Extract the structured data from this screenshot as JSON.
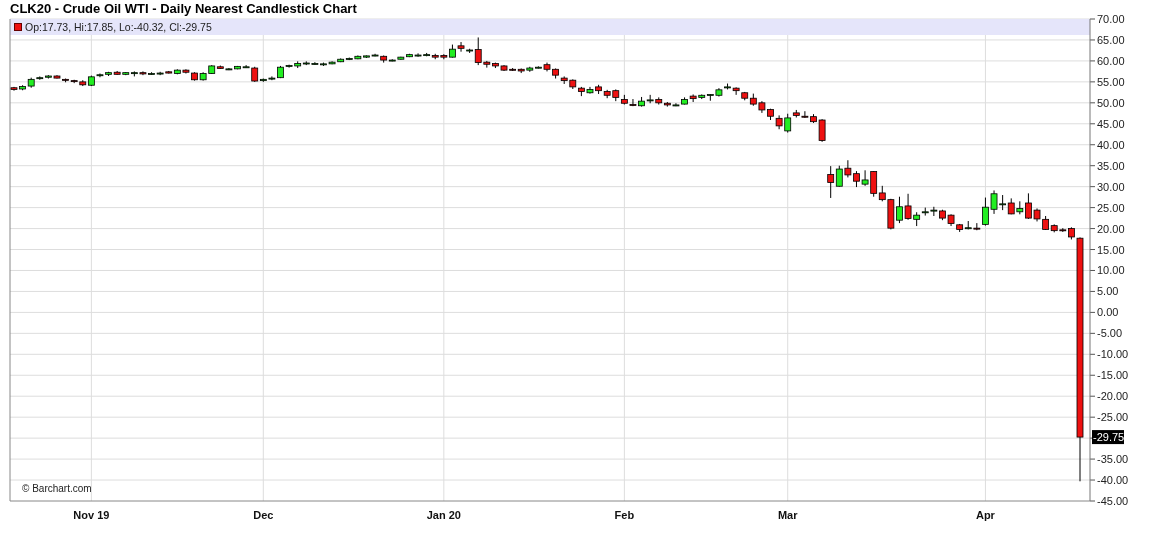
{
  "title": "CLK20 - Crude Oil WTI - Daily Nearest Candlestick Chart",
  "legend": {
    "text": "Op:17.73, Hi:17.85, Lo:-40.32, Cl:-29.75"
  },
  "copyright": "© Barchart.com",
  "chart": {
    "last_price_label": "-29.75",
    "chart_data": {
      "type": "candlestick",
      "grid": true,
      "ylim": [
        -45,
        70
      ],
      "yticks": [
        {
          "value": 70,
          "label": "70.00"
        },
        {
          "value": 65,
          "label": "65.00"
        },
        {
          "value": 60,
          "label": "60.00"
        },
        {
          "value": 55,
          "label": "55.00"
        },
        {
          "value": 50,
          "label": "50.00"
        },
        {
          "value": 45,
          "label": "45.00"
        },
        {
          "value": 40,
          "label": "40.00"
        },
        {
          "value": 35,
          "label": "35.00"
        },
        {
          "value": 30,
          "label": "30.00"
        },
        {
          "value": 25,
          "label": "25.00"
        },
        {
          "value": 20,
          "label": "20.00"
        },
        {
          "value": 15,
          "label": "15.00"
        },
        {
          "value": 10,
          "label": "10.00"
        },
        {
          "value": 5,
          "label": "5.00"
        },
        {
          "value": 0,
          "label": "0.00"
        },
        {
          "value": -5,
          "label": "-5.00"
        },
        {
          "value": -10,
          "label": "-10.00"
        },
        {
          "value": -15,
          "label": "-15.00"
        },
        {
          "value": -20,
          "label": "-20.00"
        },
        {
          "value": -25,
          "label": "-25.00"
        },
        {
          "value": -35,
          "label": "-35.00"
        },
        {
          "value": -40,
          "label": "-40.00"
        },
        {
          "value": -45,
          "label": "-45.00"
        }
      ],
      "categories": [
        null,
        null,
        null,
        null,
        null,
        null,
        null,
        null,
        null,
        "Nov 19",
        null,
        null,
        null,
        null,
        null,
        null,
        null,
        null,
        null,
        null,
        null,
        null,
        null,
        null,
        null,
        null,
        null,
        null,
        null,
        "Dec",
        null,
        null,
        null,
        null,
        null,
        null,
        null,
        null,
        null,
        null,
        null,
        null,
        null,
        null,
        null,
        null,
        null,
        null,
        null,
        null,
        "Jan 20",
        null,
        null,
        null,
        null,
        null,
        null,
        null,
        null,
        null,
        null,
        null,
        null,
        null,
        null,
        null,
        null,
        null,
        null,
        null,
        null,
        "Feb",
        null,
        null,
        null,
        null,
        null,
        null,
        null,
        null,
        null,
        null,
        null,
        null,
        null,
        null,
        null,
        null,
        null,
        null,
        "Mar",
        null,
        null,
        null,
        null,
        null,
        null,
        null,
        null,
        null,
        null,
        null,
        null,
        null,
        null,
        null,
        null,
        null,
        null,
        null,
        null,
        null,
        null,
        "Apr",
        null,
        null,
        null,
        null,
        null,
        null,
        null,
        null,
        null,
        null,
        null
      ],
      "ohlc": [
        [
          53.6,
          53.8,
          52.9,
          53.2
        ],
        [
          53.3,
          54.2,
          53.0,
          53.9
        ],
        [
          54.0,
          56.0,
          53.6,
          55.6
        ],
        [
          55.9,
          56.3,
          55.5,
          56.0
        ],
        [
          56.1,
          56.6,
          55.8,
          56.4
        ],
        [
          56.4,
          56.6,
          55.8,
          55.9
        ],
        [
          55.6,
          55.8,
          54.9,
          55.5
        ],
        [
          55.3,
          55.5,
          54.7,
          55.2
        ],
        [
          55.0,
          55.4,
          54.0,
          54.3
        ],
        [
          54.2,
          56.5,
          54.0,
          56.2
        ],
        [
          56.6,
          57.0,
          56.1,
          56.7
        ],
        [
          56.8,
          57.4,
          56.4,
          57.2
        ],
        [
          57.3,
          57.6,
          56.7,
          56.8
        ],
        [
          56.8,
          57.3,
          56.6,
          57.2
        ],
        [
          57.2,
          57.5,
          56.3,
          57.2
        ],
        [
          57.2,
          57.5,
          56.6,
          56.9
        ],
        [
          57.0,
          57.3,
          56.7,
          57.0
        ],
        [
          57.0,
          57.4,
          56.6,
          57.1
        ],
        [
          57.4,
          57.6,
          57.0,
          57.1
        ],
        [
          57.0,
          58.0,
          56.8,
          57.8
        ],
        [
          57.8,
          58.0,
          57.0,
          57.3
        ],
        [
          57.1,
          57.3,
          55.3,
          55.5
        ],
        [
          55.5,
          57.3,
          55.3,
          57.0
        ],
        [
          57.0,
          59.0,
          56.9,
          58.8
        ],
        [
          58.6,
          58.9,
          58.1,
          58.2
        ],
        [
          58.1,
          58.3,
          57.8,
          58.1
        ],
        [
          58.1,
          58.8,
          58.0,
          58.7
        ],
        [
          58.6,
          59.0,
          58.3,
          58.6
        ],
        [
          58.3,
          58.6,
          55.0,
          55.2
        ],
        [
          55.3,
          55.8,
          55.0,
          55.6
        ],
        [
          55.9,
          56.3,
          55.4,
          55.9
        ],
        [
          56.0,
          58.8,
          55.9,
          58.5
        ],
        [
          58.8,
          59.1,
          58.4,
          58.9
        ],
        [
          58.8,
          59.9,
          58.3,
          59.4
        ],
        [
          59.5,
          59.9,
          59.0,
          59.5
        ],
        [
          59.4,
          59.7,
          59.1,
          59.4
        ],
        [
          59.3,
          59.6,
          58.8,
          59.3
        ],
        [
          59.3,
          59.9,
          59.2,
          59.7
        ],
        [
          59.8,
          60.6,
          59.7,
          60.4
        ],
        [
          60.5,
          60.8,
          60.2,
          60.6
        ],
        [
          60.5,
          61.3,
          60.4,
          61.1
        ],
        [
          60.9,
          61.3,
          60.7,
          61.2
        ],
        [
          61.4,
          61.7,
          61.1,
          61.4
        ],
        [
          61.1,
          61.3,
          59.6,
          60.2
        ],
        [
          60.2,
          60.4,
          59.9,
          60.2
        ],
        [
          60.4,
          61.0,
          60.3,
          60.9
        ],
        [
          61.0,
          61.7,
          60.9,
          61.5
        ],
        [
          61.4,
          61.8,
          61.0,
          61.4
        ],
        [
          61.5,
          61.9,
          61.1,
          61.5
        ],
        [
          61.3,
          61.7,
          60.4,
          60.9
        ],
        [
          61.3,
          61.6,
          60.4,
          60.9
        ],
        [
          60.9,
          63.9,
          60.8,
          62.8
        ],
        [
          63.6,
          64.5,
          62.2,
          63.0
        ],
        [
          62.4,
          62.9,
          61.9,
          62.6
        ],
        [
          62.7,
          65.6,
          59.0,
          59.6
        ],
        [
          59.7,
          60.0,
          58.4,
          59.2
        ],
        [
          59.4,
          59.6,
          58.3,
          58.8
        ],
        [
          58.8,
          59.0,
          57.6,
          57.8
        ],
        [
          58.0,
          58.3,
          57.6,
          57.9
        ],
        [
          58.0,
          58.2,
          57.1,
          57.6
        ],
        [
          57.8,
          58.6,
          57.4,
          58.3
        ],
        [
          58.4,
          58.7,
          58.2,
          58.5
        ],
        [
          59.1,
          59.6,
          57.5,
          58.0
        ],
        [
          58.0,
          58.2,
          55.8,
          56.6
        ],
        [
          55.9,
          56.3,
          54.5,
          55.3
        ],
        [
          55.4,
          55.6,
          53.3,
          53.8
        ],
        [
          53.5,
          53.8,
          51.6,
          52.7
        ],
        [
          52.4,
          53.8,
          52.2,
          53.2
        ],
        [
          53.8,
          54.3,
          52.1,
          52.9
        ],
        [
          52.7,
          53.1,
          51.1,
          51.8
        ],
        [
          52.9,
          53.2,
          50.4,
          51.3
        ],
        [
          50.8,
          51.9,
          49.6,
          49.9
        ],
        [
          49.6,
          50.9,
          49.2,
          49.5
        ],
        [
          49.3,
          51.4,
          49.1,
          50.4
        ],
        [
          50.7,
          51.9,
          49.9,
          50.7
        ],
        [
          50.8,
          51.3,
          49.6,
          50.0
        ],
        [
          49.9,
          50.2,
          49.1,
          49.5
        ],
        [
          49.4,
          49.9,
          49.2,
          49.5
        ],
        [
          49.7,
          51.3,
          49.6,
          50.8
        ],
        [
          51.6,
          52.0,
          50.2,
          51.0
        ],
        [
          51.3,
          52.0,
          50.9,
          51.8
        ],
        [
          51.9,
          52.1,
          50.5,
          52.0
        ],
        [
          51.8,
          53.5,
          51.5,
          53.1
        ],
        [
          53.7,
          54.6,
          53.2,
          53.8
        ],
        [
          53.5,
          53.7,
          51.9,
          52.9
        ],
        [
          52.4,
          52.6,
          50.6,
          51.1
        ],
        [
          51.1,
          52.2,
          49.3,
          49.7
        ],
        [
          50.0,
          50.4,
          47.6,
          48.3
        ],
        [
          48.4,
          48.6,
          45.9,
          46.8
        ],
        [
          46.3,
          47.0,
          43.7,
          44.5
        ],
        [
          43.3,
          47.4,
          42.9,
          46.4
        ],
        [
          47.6,
          48.3,
          46.5,
          47.0
        ],
        [
          46.8,
          48.0,
          46.4,
          46.7
        ],
        [
          46.7,
          47.3,
          45.2,
          45.5
        ],
        [
          45.9,
          46.1,
          40.7,
          41.0
        ],
        [
          32.9,
          34.9,
          27.3,
          31.0
        ],
        [
          30.1,
          35.0,
          30.0,
          34.2
        ],
        [
          34.4,
          36.3,
          32.2,
          32.8
        ],
        [
          33.1,
          33.7,
          29.9,
          31.3
        ],
        [
          30.6,
          33.9,
          30.2,
          31.6
        ],
        [
          33.6,
          33.7,
          27.6,
          28.4
        ],
        [
          28.5,
          30.2,
          26.5,
          26.9
        ],
        [
          26.9,
          27.1,
          19.8,
          20.1
        ],
        [
          22.0,
          27.6,
          21.3,
          25.2
        ],
        [
          25.4,
          28.3,
          22.1,
          22.4
        ],
        [
          22.2,
          23.9,
          20.6,
          23.2
        ],
        [
          23.8,
          25.0,
          23.1,
          24.0
        ],
        [
          24.3,
          25.2,
          23.0,
          24.4
        ],
        [
          24.2,
          24.5,
          22.0,
          22.5
        ],
        [
          23.2,
          23.4,
          20.6,
          21.2
        ],
        [
          20.9,
          21.1,
          19.2,
          19.8
        ],
        [
          20.1,
          21.8,
          19.8,
          20.2
        ],
        [
          20.1,
          21.3,
          19.6,
          20.0
        ],
        [
          21.0,
          27.4,
          20.7,
          25.1
        ],
        [
          24.6,
          29.1,
          23.5,
          28.3
        ],
        [
          25.8,
          28.0,
          24.4,
          25.9
        ],
        [
          26.1,
          27.2,
          23.4,
          23.5
        ],
        [
          24.0,
          26.5,
          23.4,
          24.8
        ],
        [
          26.1,
          28.4,
          22.3,
          22.5
        ],
        [
          24.4,
          24.8,
          21.7,
          22.3
        ],
        [
          22.2,
          23.0,
          19.7,
          19.8
        ],
        [
          20.7,
          21.0,
          19.1,
          19.5
        ],
        [
          19.7,
          20.1,
          19.2,
          19.6
        ],
        [
          20.0,
          20.3,
          17.4,
          18.0
        ],
        [
          17.7,
          17.9,
          -40.3,
          -29.75
        ]
      ]
    }
  }
}
